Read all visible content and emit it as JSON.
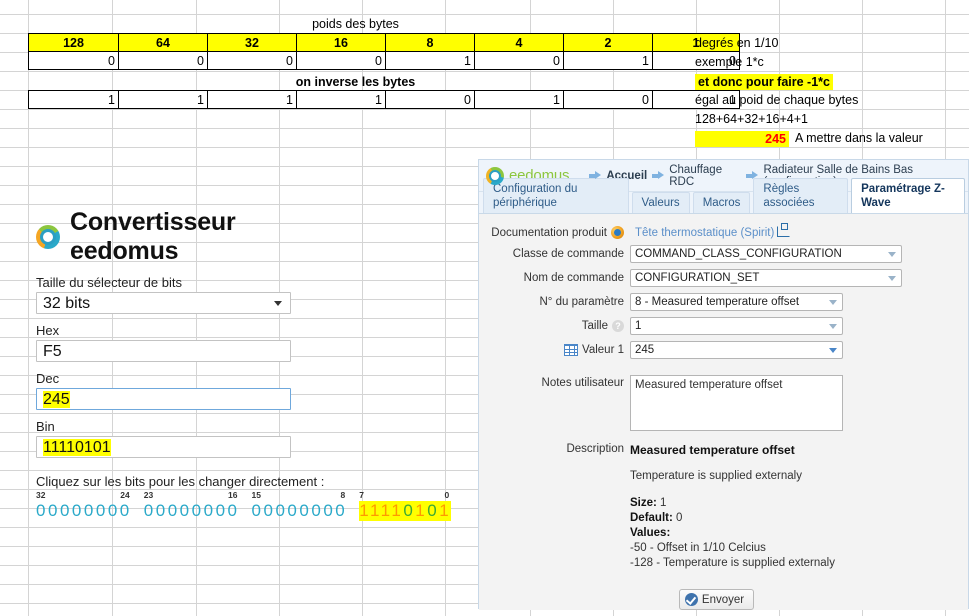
{
  "spreadsheet": {
    "label_poids": "poids des bytes",
    "label_inverse": "on inverse les bytes",
    "weights": [
      "128",
      "64",
      "32",
      "16",
      "8",
      "4",
      "2",
      "1"
    ],
    "row_original": [
      "0",
      "0",
      "0",
      "0",
      "1",
      "0",
      "1",
      "0"
    ],
    "row_inverted": [
      "1",
      "1",
      "1",
      "1",
      "0",
      "1",
      "0",
      "1"
    ],
    "notes": {
      "degres": "degrés en 1/10",
      "exemple": "exemple 1*c",
      "et_donc": "et donc pour faire -1*c",
      "egal": "égal au poid de chaque bytes",
      "somme": "128+64+32+16+4+1",
      "resultat": "245",
      "a_mettre": "A  mettre dans la valeur"
    }
  },
  "converter": {
    "title": "Convertisseur eedomus",
    "logo_icon": "eedomus-ring-icon",
    "size_label": "Taille du sélecteur de bits",
    "size_value": "32 bits",
    "hex_label": "Hex",
    "hex_value": "F5",
    "dec_label": "Dec",
    "dec_value": "245",
    "bin_label": "Bin",
    "bin_value": "11110101",
    "hint": "Cliquez sur les bits pour les changer directement :",
    "bit_groups": [
      {
        "hi": "32",
        "lo": "24",
        "bits": "00000000",
        "highlighted": false
      },
      {
        "hi": "23",
        "lo": "16",
        "bits": "00000000",
        "highlighted": false
      },
      {
        "hi": "15",
        "lo": "8",
        "bits": "00000000",
        "highlighted": false
      },
      {
        "hi": "7",
        "lo": "0",
        "bits": "11110101",
        "highlighted": true
      }
    ]
  },
  "eedomus": {
    "brand": "eedomus",
    "breadcrumbs": [
      {
        "label": "Accueil"
      },
      {
        "label": "Chauffage RDC"
      },
      {
        "label": "Radiateur Salle de Bains Bas (configuration)"
      }
    ],
    "tabs": [
      {
        "label": "Configuration du périphérique",
        "active": false
      },
      {
        "label": "Valeurs",
        "active": false
      },
      {
        "label": "Macros",
        "active": false
      },
      {
        "label": "Règles associées",
        "active": false
      },
      {
        "label": "Paramétrage Z-Wave",
        "active": true
      }
    ],
    "form": {
      "doc_label": "Documentation produit",
      "doc_link": "Tête thermostatique (Spirit)",
      "cmd_class_label": "Classe de commande",
      "cmd_class_value": "COMMAND_CLASS_CONFIGURATION",
      "cmd_name_label": "Nom de commande",
      "cmd_name_value": "CONFIGURATION_SET",
      "param_label": "N° du paramètre",
      "param_value": "8 - Measured temperature offset",
      "size_label": "Taille",
      "size_value": "1",
      "value_label": "Valeur 1",
      "value_value": "245",
      "notes_label": "Notes utilisateur",
      "notes_value": "Measured temperature offset",
      "desc_label": "Description",
      "desc_title": "Measured temperature offset",
      "desc_line1": "Temperature is supplied externaly",
      "desc_size_k": "Size:",
      "desc_size_v": "1",
      "desc_default_k": "Default:",
      "desc_default_v": "0",
      "desc_values_k": "Values:",
      "desc_val1": "-50 - Offset in 1/10 Celcius",
      "desc_val2": "-128 - Temperature is supplied externaly",
      "submit_label": "Envoyer"
    }
  },
  "colors": {
    "highlight": "#ffff00",
    "red": "#ff0000",
    "bit_one": "#ff9900",
    "bit_zero": "#2aa9c9",
    "brand_green": "#8cc63f",
    "link_blue": "#5b8fc9"
  }
}
